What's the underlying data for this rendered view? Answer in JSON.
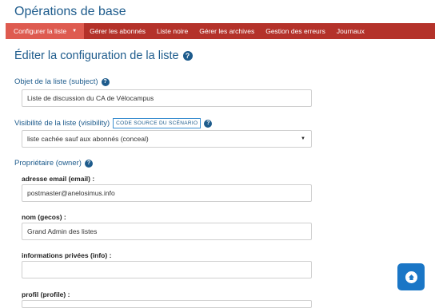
{
  "header": {
    "title": "Opérations de base"
  },
  "nav": {
    "items": [
      {
        "label": "Configurer la liste",
        "active": true
      },
      {
        "label": "Gérer les abonnés"
      },
      {
        "label": "Liste noire"
      },
      {
        "label": "Gérer les archives"
      },
      {
        "label": "Gestion des erreurs"
      },
      {
        "label": "Journaux"
      }
    ]
  },
  "main": {
    "title": "Éditer la configuration de la liste",
    "subject": {
      "label": "Objet de la liste (subject)",
      "value": "Liste de discussion du CA de Vélocampus"
    },
    "visibility": {
      "label": "Visibilité de la liste (visibility)",
      "scenario_button": "CODE SOURCE DU SCÉNARIO",
      "selected": "liste cachée sauf aux abonnés (conceal)"
    },
    "owner": {
      "label": "Propriétaire (owner)",
      "email_label": "adresse email (email) :",
      "email_value": "postmaster@anelosimus.info",
      "gecos_label": "nom (gecos) :",
      "gecos_value": "Grand Admin des listes",
      "info_label": "informations privées (info) :",
      "info_value": "",
      "profile_label": "profil (profile) :"
    }
  },
  "icons": {
    "help": "question-circle-icon",
    "scroll_top": "arrow-up-circle-icon"
  },
  "colors": {
    "navbar": "#b4322a",
    "nav_active": "#de5b50",
    "primary": "#1d5b8c",
    "scroll_button": "#1a76c6"
  }
}
